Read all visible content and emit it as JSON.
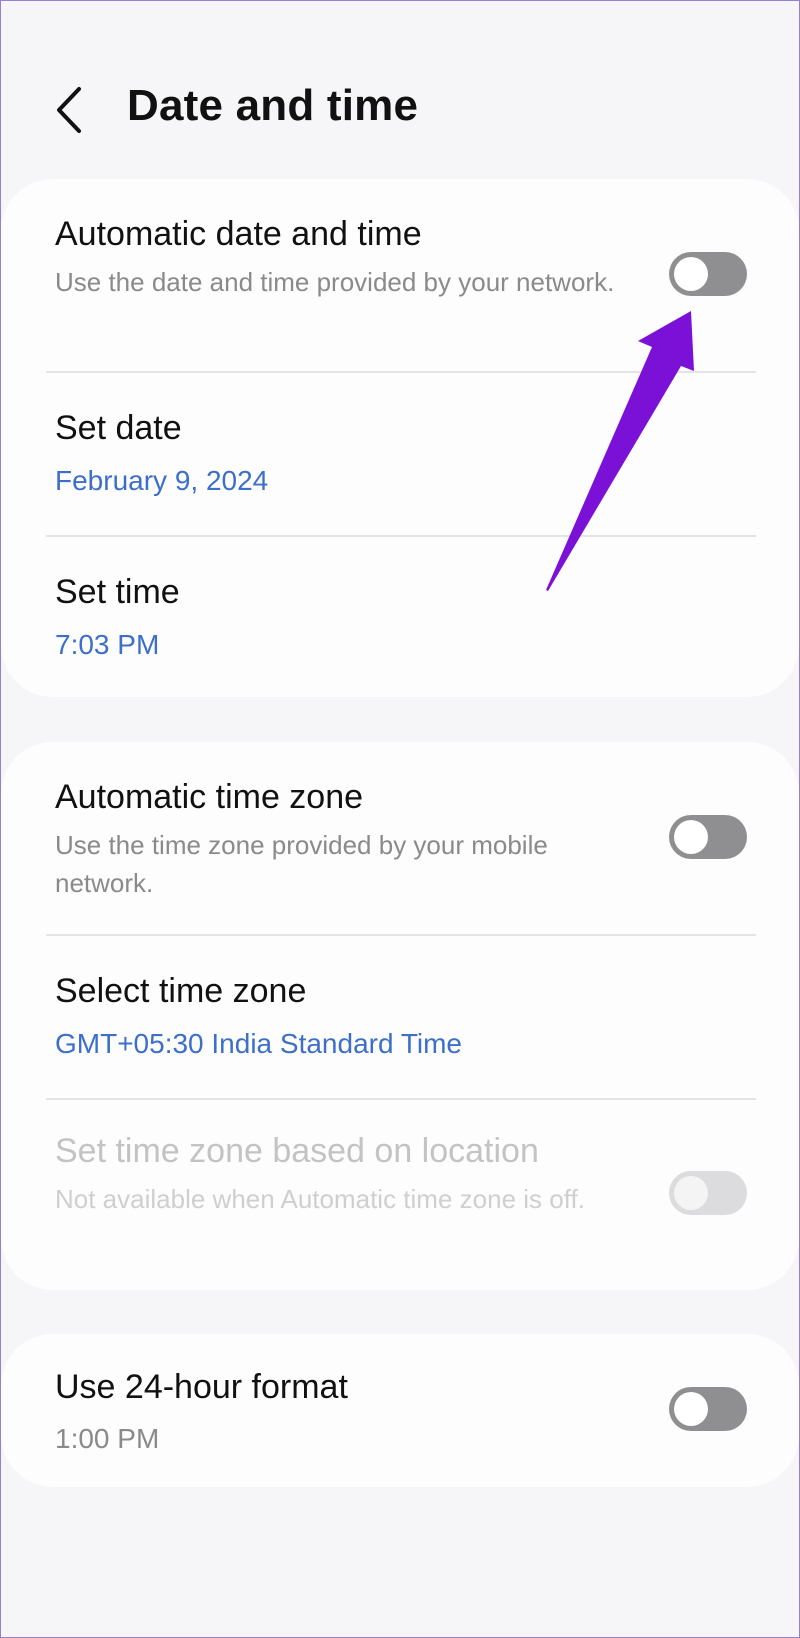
{
  "header": {
    "title": "Date and time",
    "back_icon": "chevron-left-icon"
  },
  "groups": [
    {
      "rows": [
        {
          "title": "Automatic date and time",
          "subtitle": "Use the date and time provided by your network.",
          "toggle": "off"
        },
        {
          "title": "Set date",
          "value": "February 9, 2024"
        },
        {
          "title": "Set time",
          "value": "7:03 PM"
        }
      ]
    },
    {
      "rows": [
        {
          "title": "Automatic time zone",
          "subtitle": "Use the time zone provided by your mobile network.",
          "toggle": "off"
        },
        {
          "title": "Select time zone",
          "value": "GMT+05:30 India Standard Time"
        },
        {
          "title": "Set time zone based on location",
          "subtitle": "Not available when Automatic time zone is off.",
          "toggle": "off",
          "state": "disabled"
        }
      ]
    },
    {
      "rows": [
        {
          "title": "Use 24-hour format",
          "value": "1:00 PM",
          "toggle": "off"
        }
      ]
    }
  ],
  "colors": {
    "accent_value": "#3d6fc9",
    "annotation_arrow": "#7b10d6",
    "toggle_off": "#8f8f91",
    "background": "#f6f6f8",
    "card": "#fdfdfe"
  },
  "annotation": {
    "arrow_icon": "arrow-annotation-icon",
    "points_to": "automatic-date-time-toggle"
  }
}
